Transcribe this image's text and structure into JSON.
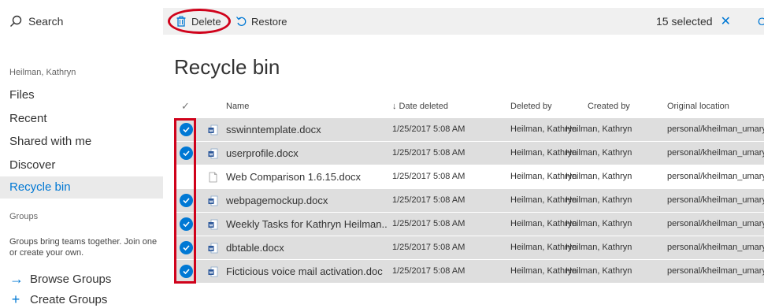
{
  "sidebar": {
    "search_label": "Search",
    "user_name": "Heilman, Kathryn",
    "nav": [
      {
        "label": "Files"
      },
      {
        "label": "Recent"
      },
      {
        "label": "Shared with me"
      },
      {
        "label": "Discover"
      },
      {
        "label": "Recycle bin",
        "active": true
      }
    ],
    "groups_label": "Groups",
    "groups_desc": "Groups bring teams together. Join one or create your own.",
    "browse_groups": "Browse Groups",
    "create_groups": "Create Groups"
  },
  "toolbar": {
    "delete_label": "Delete",
    "restore_label": "Restore",
    "selected_label": "15 selected",
    "edge_glyph": "C"
  },
  "page_title": "Recycle bin",
  "table": {
    "headers": {
      "name": "Name",
      "date_deleted": "↓ Date deleted",
      "deleted_by": "Deleted by",
      "created_by": "Created by",
      "original_location": "Original location"
    },
    "rows": [
      {
        "name": "sswinntemplate.docx",
        "date": "1/25/2017 5:08 AM",
        "deleted_by": "Heilman, Kathryn",
        "created_by": "Heilman, Kathryn",
        "location": "personal/kheilman_umary",
        "selected": true,
        "icon": "word"
      },
      {
        "name": "userprofile.docx",
        "date": "1/25/2017 5:08 AM",
        "deleted_by": "Heilman, Kathryn",
        "created_by": "Heilman, Kathryn",
        "location": "personal/kheilman_umary",
        "selected": true,
        "icon": "word"
      },
      {
        "name": "Web Comparison 1.6.15.docx",
        "date": "1/25/2017 5:08 AM",
        "deleted_by": "Heilman, Kathryn",
        "created_by": "Heilman, Kathryn",
        "location": "personal/kheilman_umary",
        "selected": false,
        "icon": "generic"
      },
      {
        "name": "webpagemockup.docx",
        "date": "1/25/2017 5:08 AM",
        "deleted_by": "Heilman, Kathryn",
        "created_by": "Heilman, Kathryn",
        "location": "personal/kheilman_umary",
        "selected": true,
        "icon": "word"
      },
      {
        "name": "Weekly Tasks for Kathryn Heilman....",
        "date": "1/25/2017 5:08 AM",
        "deleted_by": "Heilman, Kathryn",
        "created_by": "Heilman, Kathryn",
        "location": "personal/kheilman_umary",
        "selected": true,
        "icon": "word"
      },
      {
        "name": "dbtable.docx",
        "date": "1/25/2017 5:08 AM",
        "deleted_by": "Heilman, Kathryn",
        "created_by": "Heilman, Kathryn",
        "location": "personal/kheilman_umary",
        "selected": true,
        "icon": "word"
      },
      {
        "name": "Ficticious voice mail activation.doc",
        "date": "1/25/2017 5:08 AM",
        "deleted_by": "Heilman, Kathryn",
        "created_by": "Heilman, Kathryn",
        "location": "personal/kheilman_umary",
        "selected": true,
        "icon": "word"
      }
    ]
  },
  "colors": {
    "accent": "#0078d4",
    "highlight_red": "#d0021b",
    "selected_row_bg": "#dedede"
  }
}
